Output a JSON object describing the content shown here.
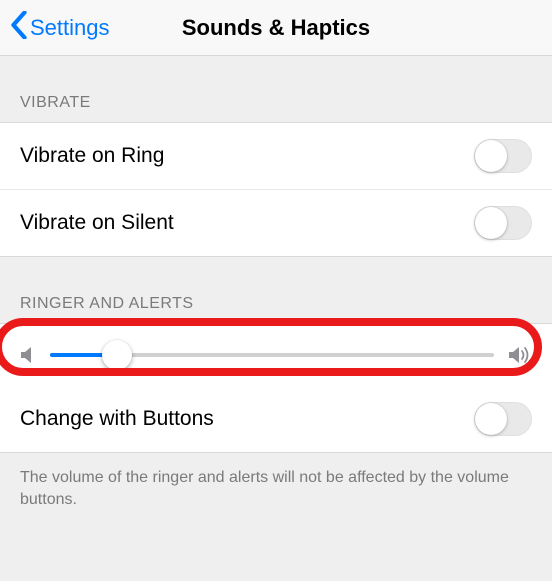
{
  "header": {
    "back_label": "Settings",
    "title": "Sounds & Haptics"
  },
  "vibrate": {
    "section_label": "Vibrate",
    "ring_label": "Vibrate on Ring",
    "ring_on": false,
    "silent_label": "Vibrate on Silent",
    "silent_on": false
  },
  "ringer": {
    "section_label": "Ringer and Alerts",
    "volume_percent": 15,
    "change_label": "Change with Buttons",
    "change_on": false
  },
  "footer": {
    "text": "The volume of the ringer and alerts will not be affected by the volume buttons."
  },
  "annotation": {
    "highlight_color": "#ea1a1a"
  }
}
